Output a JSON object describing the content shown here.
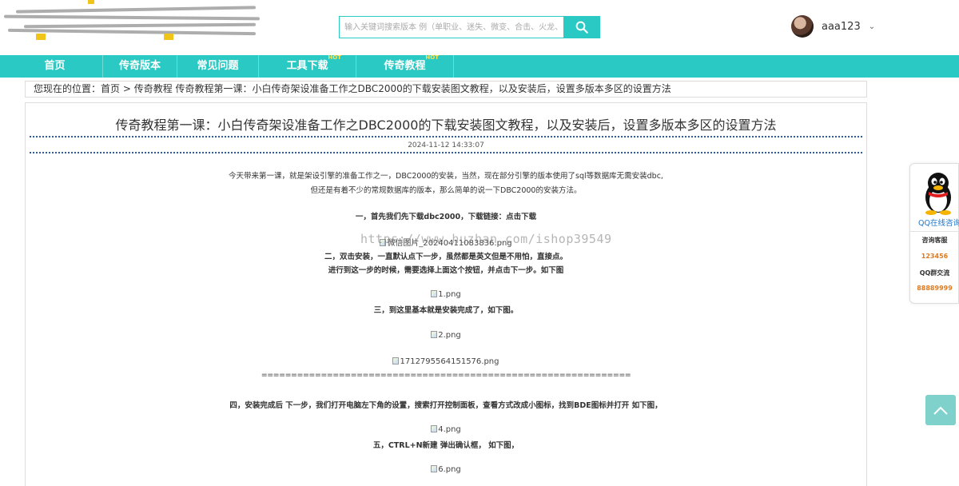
{
  "search": {
    "placeholder": "输入关键词搜索版本 例（单职业、迷失、微变、合击、火龙、中变"
  },
  "user": {
    "name": "aaa123"
  },
  "nav": [
    {
      "label": "首页",
      "hot": ""
    },
    {
      "label": "传奇版本",
      "hot": ""
    },
    {
      "label": "常见问题",
      "hot": ""
    },
    {
      "label": "工具下载",
      "hot": "HOT"
    },
    {
      "label": "传奇教程",
      "hot": "HOT"
    }
  ],
  "breadcrumb": {
    "prefix": "您现在的位置：",
    "home": "首页",
    "sep": " > ",
    "category": "传奇教程",
    "current": " 传奇教程第一课：小白传奇架设准备工作之DBC2000的下载安装图文教程，以及安装后，设置多版本多区的设置方法"
  },
  "article": {
    "title": "传奇教程第一课：小白传奇架设准备工作之DBC2000的下载安装图文教程，以及安装后，设置多版本多区的设置方法",
    "date": "2024-11-12 14:33:07",
    "intro1": "今天带来第一课，就是架设引擎的准备工作之一，DBC2000的安装，当然，现在部分引擎的版本使用了sql等数据库无需安装dbc,",
    "intro2": "但还是有着不少的常规数据库的版本，那么简单的说一下DBC2000的安装方法。",
    "step1": "一，首先我们先下载dbc2000，下载链接：点击下载",
    "img1": "微信图片_20240411083836.png",
    "step2": "二，双击安装，一直默认点下一步，虽然都是英文但是不用怕，直接点。",
    "step2b": "进行到这一步的时候，需要选择上面这个按钮，并点击下一步。如下图",
    "img2": "1.png",
    "step3": "三，到这里基本就是安装完成了，如下图。",
    "img3": "2.png",
    "img4": "1712795564151576.png",
    "separator": "==============================================================",
    "step4": "四，安装完成后  下一步，我们打开电脑左下角的设置，搜索打开控制面板，查看方式改成小图标，找到BDE图标并打开 如下图，",
    "img5": "4.png",
    "step5": "五，CTRL+N新建 弹出确认框，   如下图，",
    "img6": "6.png"
  },
  "watermark": "https://www.huzhan.com/ishop39549",
  "sidebar": {
    "qq_online": "QQ在线咨询",
    "consult_label": "咨询客服",
    "consult_value": "123456",
    "group_label": "QQ群交流",
    "group_value": "88889999"
  },
  "colors": {
    "accent": "#2bc9c4",
    "link": "#1e74c9",
    "orange": "#e07a1f"
  }
}
